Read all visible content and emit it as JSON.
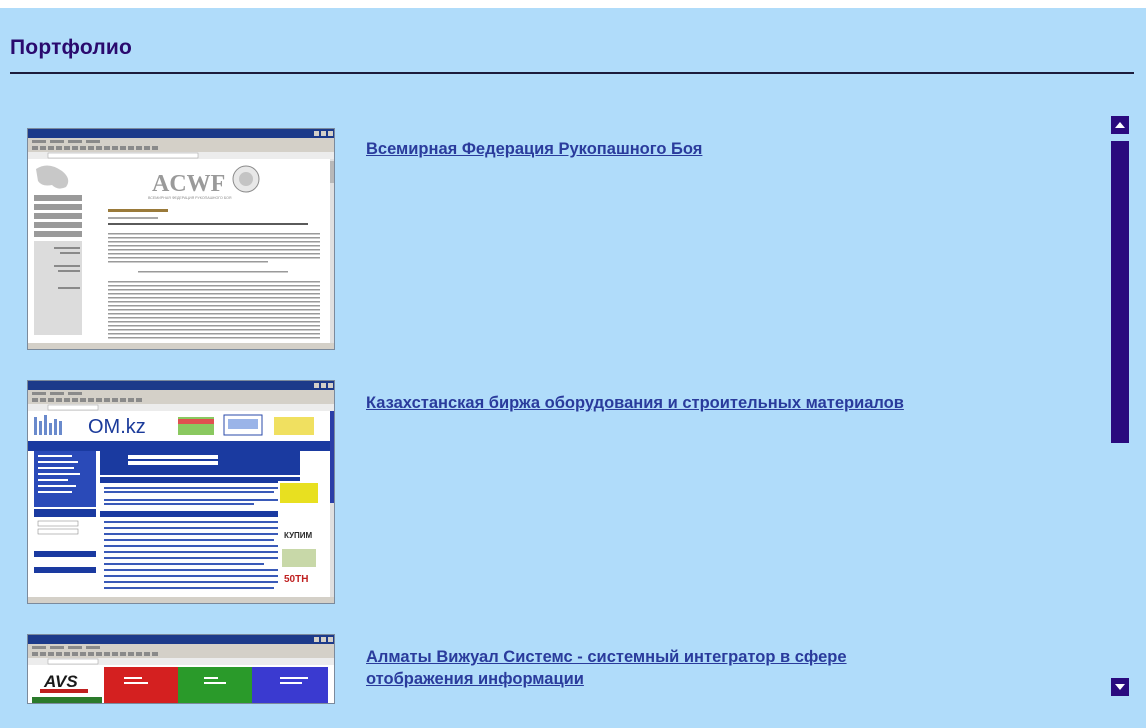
{
  "page": {
    "title": "Портфолио"
  },
  "portfolio": {
    "items": [
      {
        "link_text": "Всемирная Федерация Рукопашного Боя",
        "thumbnail": {
          "logo_text": "ACWF",
          "logo_subtext": "ВСЕМИРНАЯ ФЕДЕРАЦИЯ РУКОПАШНОГО БОЯ"
        }
      },
      {
        "link_text": "Казахстанская биржа оборудования и строительных материалов",
        "thumbnail": {
          "logo_text": "OM.kz",
          "side_labels": [
            "КУПИМ",
            "50ТН"
          ]
        }
      },
      {
        "link_text": "Алматы Вижуал Системс - системный интегратор в сфере отображения информации",
        "thumbnail": {
          "logo_text": "AVS"
        }
      }
    ]
  },
  "scrollbar": {
    "up_icon": "triangle-up-icon",
    "down_icon": "triangle-down-icon"
  },
  "colors": {
    "background": "#b0dcfa",
    "title": "#2a0a6e",
    "link": "#2a3b9c",
    "scrollbar": "#2a0a7e"
  }
}
